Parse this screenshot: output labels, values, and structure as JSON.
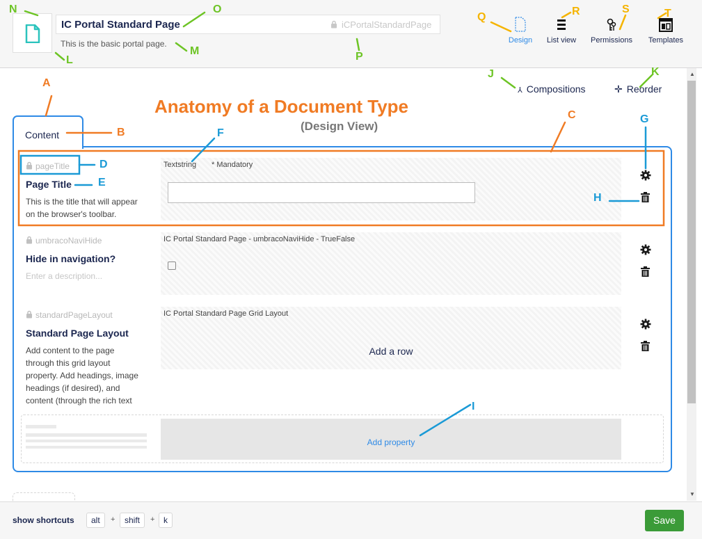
{
  "header": {
    "name": "IC Portal Standard Page",
    "alias": "iCPortalStandardPage",
    "description": "This is the basic portal page."
  },
  "app_nav": [
    {
      "label": "Design",
      "icon": "document-outline-icon",
      "active": true
    },
    {
      "label": "List view",
      "icon": "list-icon",
      "active": false
    },
    {
      "label": "Permissions",
      "icon": "keys-icon",
      "active": false
    },
    {
      "label": "Templates",
      "icon": "layout-icon",
      "active": false
    }
  ],
  "toolbar": {
    "compositions_label": "Compositions",
    "reorder_label": "Reorder"
  },
  "tabs": [
    {
      "label": "Content"
    }
  ],
  "properties": [
    {
      "alias": "pageTitle",
      "label": "Page Title",
      "description_lines": [
        "This is the title that will appear",
        "on the browser's toolbar."
      ],
      "editor": "Textstring",
      "mandatory": "* Mandatory"
    },
    {
      "alias": "umbracoNaviHide",
      "label": "Hide in navigation?",
      "description_lines": [
        "Enter a description..."
      ],
      "editor": "IC Portal Standard Page - umbracoNaviHide - TrueFalse"
    },
    {
      "alias": "standardPageLayout",
      "label": "Standard Page Layout",
      "description_lines": [
        "Add content to the page",
        "through this grid layout",
        "property. Add headings, image",
        "headings (if desired), and",
        "content (through the rich text"
      ],
      "editor": "IC Portal Standard Page Grid Layout",
      "editor_placeholder": "Add a row"
    }
  ],
  "add_property_label": "Add property",
  "footer": {
    "shortcuts_label": "show shortcuts",
    "keys": [
      "alt",
      "shift",
      "k"
    ],
    "plus": "+",
    "save_label": "Save"
  },
  "annotation": {
    "title": "Anatomy of a Document Type",
    "subtitle": "(Design View)",
    "letters": [
      "A",
      "B",
      "C",
      "D",
      "E",
      "F",
      "G",
      "H",
      "I",
      "J",
      "K",
      "L",
      "M",
      "N",
      "O",
      "P",
      "Q",
      "R",
      "S",
      "T"
    ]
  },
  "colors": {
    "accent_blue": "#2e8ae6",
    "annotation_orange": "#f07b24",
    "annotation_green": "#6dc425",
    "annotation_blue": "#1a9ad6",
    "annotation_yellow": "#f5b400",
    "save_green": "#3b9b38",
    "doc_icon_teal": "#2bc3bd"
  }
}
